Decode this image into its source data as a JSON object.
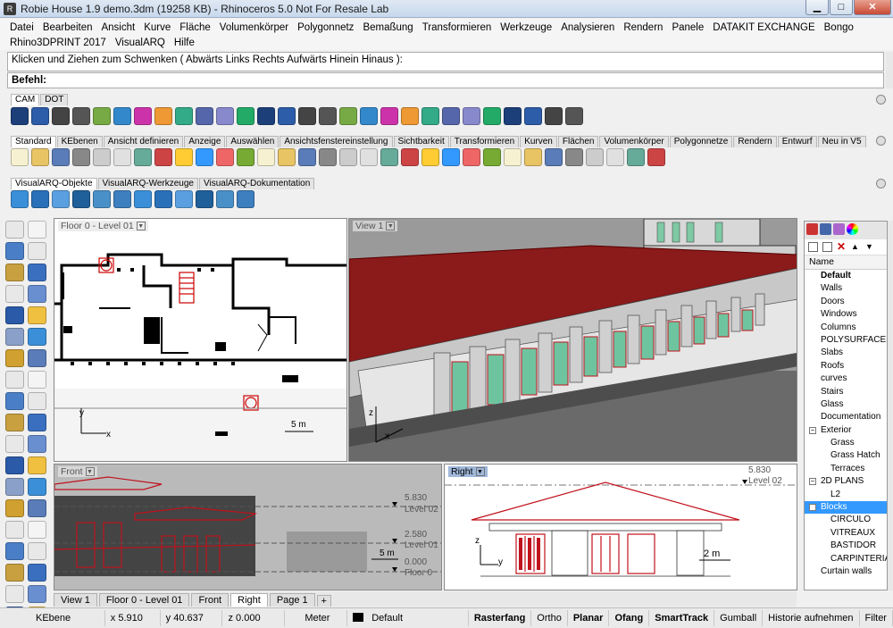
{
  "title": "Robie House 1.9 demo.3dm (19258 KB) - Rhinoceros 5.0 Not For Resale Lab",
  "menu": [
    "Datei",
    "Bearbeiten",
    "Ansicht",
    "Kurve",
    "Fläche",
    "Volumenkörper",
    "Polygonnetz",
    "Bemaßung",
    "Transformieren",
    "Werkzeuge",
    "Analysieren",
    "Rendern",
    "Panele",
    "DATAKIT EXCHANGE",
    "Bongo",
    "Rhino3DPRINT 2017",
    "VisualARQ",
    "Hilfe"
  ],
  "command": {
    "history": "Klicken und Ziehen zum Schwenken ( Abwärts  Links  Rechts  Aufwärts  Hinein  Hinaus ):",
    "prompt": "Befehl:"
  },
  "toolbar_groups": {
    "cam": [
      "CAM",
      "DOT"
    ],
    "standard": [
      "Standard",
      "KEbenen",
      "Ansicht definieren",
      "Anzeige",
      "Auswählen",
      "Ansichtsfenstereinstellung",
      "Sichtbarkeit",
      "Transformieren",
      "Kurven",
      "Flächen",
      "Volumenkörper",
      "Polygonnetze",
      "Rendern",
      "Entwurf",
      "Neu in V5"
    ],
    "visualarq": [
      "VisualARQ-Objekte",
      "VisualARQ-Werkzeuge",
      "VisualARQ-Dokumentation"
    ]
  },
  "viewports": {
    "top_left": {
      "title": "Floor 0 - Level 01",
      "scale": "5 m",
      "axis_x": "x",
      "axis_y": "y"
    },
    "perspective": {
      "title": "View 1",
      "axis_z": "z",
      "axis_x": "x"
    },
    "front": {
      "title": "Front",
      "levels": [
        {
          "value": "5.830",
          "name": "Level 02"
        },
        {
          "value": "2.580",
          "name": "Level 01"
        },
        {
          "value": "0.000",
          "name": "Floor 0"
        }
      ],
      "scale": "5 m"
    },
    "right": {
      "title": "Right",
      "levels": [
        {
          "value": "5.830",
          "name": "Level 02"
        }
      ],
      "scale": "2 m",
      "axis_z": "z",
      "axis_y": "y"
    }
  },
  "viewport_tabs": [
    "View 1",
    "Floor 0 - Level 01",
    "Front",
    "Right",
    "Page 1"
  ],
  "active_viewport_tab": "Right",
  "layers": {
    "header": "Name",
    "items": [
      {
        "name": "Default",
        "style": "bold"
      },
      {
        "name": "Walls"
      },
      {
        "name": "Doors"
      },
      {
        "name": "Windows"
      },
      {
        "name": "Columns"
      },
      {
        "name": "POLYSURFACES"
      },
      {
        "name": "Slabs"
      },
      {
        "name": "Roofs"
      },
      {
        "name": "curves"
      },
      {
        "name": "Stairs"
      },
      {
        "name": "Glass"
      },
      {
        "name": "Documentation"
      },
      {
        "name": "Exterior",
        "style": "group"
      },
      {
        "name": "Grass",
        "style": "sub"
      },
      {
        "name": "Grass Hatch",
        "style": "sub"
      },
      {
        "name": "Terraces",
        "style": "sub"
      },
      {
        "name": "2D PLANS",
        "style": "group"
      },
      {
        "name": "L2",
        "style": "sub"
      },
      {
        "name": "Blocks",
        "style": "group-selected"
      },
      {
        "name": "CIRCULO",
        "style": "sub"
      },
      {
        "name": "VITREAUX",
        "style": "sub"
      },
      {
        "name": "BASTIDOR",
        "style": "sub"
      },
      {
        "name": "CARPINTERIA",
        "style": "sub"
      },
      {
        "name": "Curtain walls"
      }
    ]
  },
  "status": {
    "layer": "KEbene",
    "x": "x 5.910",
    "y": "y 40.637",
    "z": "z 0.000",
    "units": "Meter",
    "current_layer": "Default",
    "toggles": [
      {
        "label": "Rasterfang",
        "bold": true
      },
      {
        "label": "Ortho",
        "bold": false
      },
      {
        "label": "Planar",
        "bold": true
      },
      {
        "label": "Ofang",
        "bold": true
      },
      {
        "label": "SmartTrack",
        "bold": true
      },
      {
        "label": "Gumball",
        "bold": false
      },
      {
        "label": "Historie aufnehmen",
        "bold": false
      },
      {
        "label": "Filter",
        "bold": false
      }
    ]
  },
  "colors": {
    "accent_red": "#c0121c",
    "selection": "#3399ff",
    "roof_red": "#8b1a1a"
  }
}
